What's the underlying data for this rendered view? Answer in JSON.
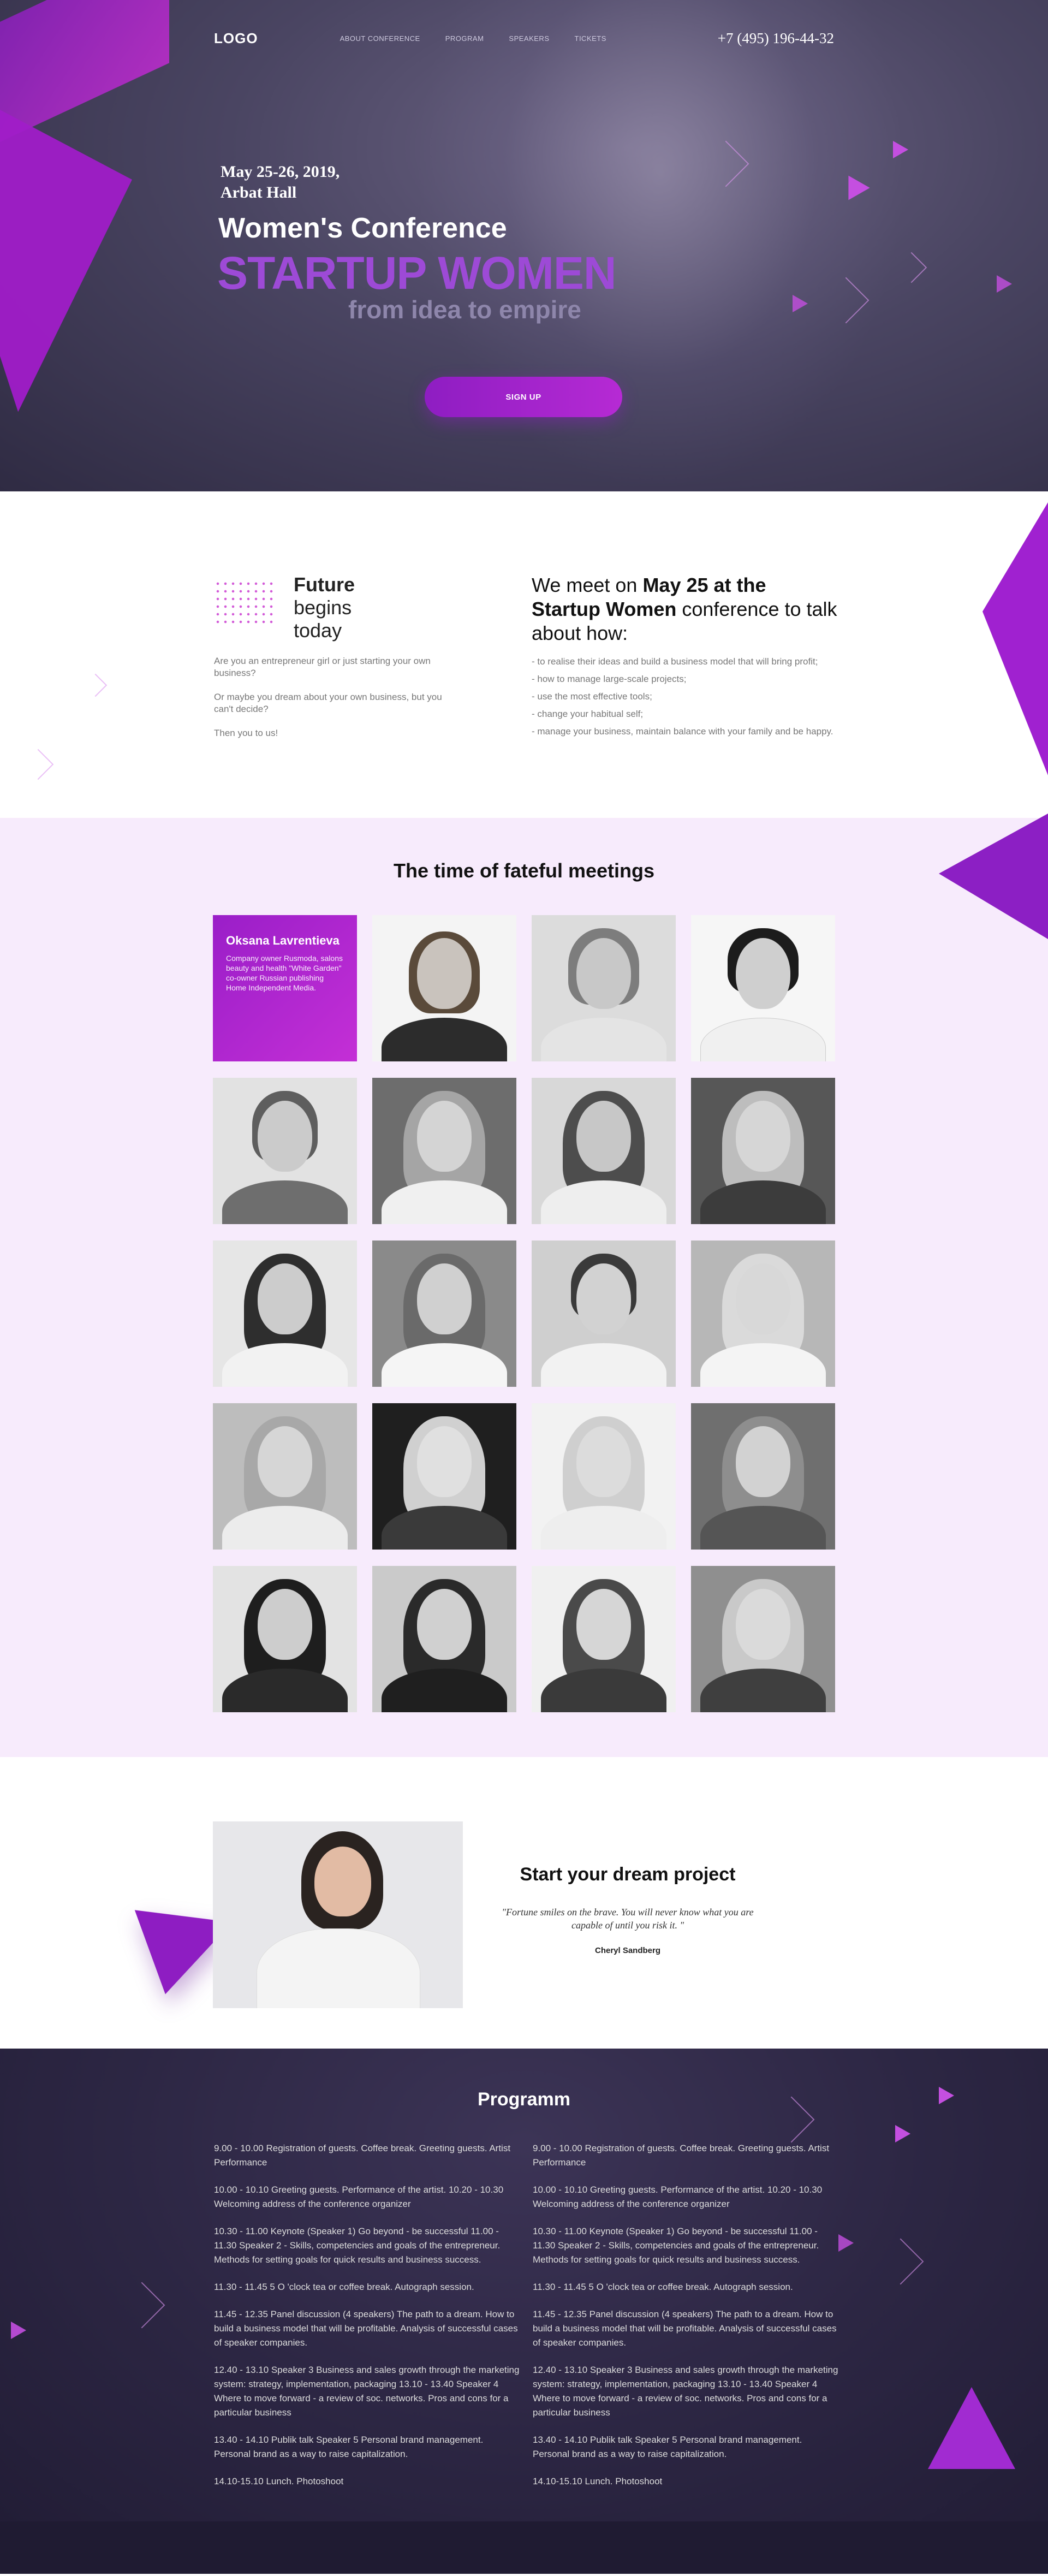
{
  "header": {
    "logo": "LOGO",
    "menu": [
      "ABOUT CONFERENCE",
      "PROGRAM",
      "SPEAKERS",
      "TICKETS"
    ],
    "phone": "+7 (495) 196-44-32"
  },
  "hero": {
    "date_line1": "May 25-26, 2019,",
    "date_line2": "Arbat Hall",
    "title1": "Women's Conference",
    "title2": "STARTUP WOMEN",
    "title3": "from idea to empire",
    "button": "SIGN UP"
  },
  "future": {
    "heading_bold": "Future",
    "heading_rest1": "begins",
    "heading_rest2": "today",
    "paragraphs": [
      "Are you an entrepreneur girl or just starting your own business?",
      "Or maybe you dream about your own business, but you can't decide?",
      "Then you to us!"
    ],
    "meet_prefix": "We meet on ",
    "meet_bold1": "May 25 at the Startup Women",
    "meet_suffix": " conference to talk about how:",
    "list": [
      "- to realise their ideas and build a business model that will bring profit;",
      "- how to manage large-scale projects;",
      "- use the most effective tools;",
      "- change your habitual self;",
      "- manage your business, maintain balance with your family and be happy."
    ]
  },
  "speakers": {
    "heading": "The time of fateful meetings",
    "featured": {
      "name": "Oksana Lavrentieva",
      "description": "Company owner Rusmoda, salons beauty and health \"White Garden\" co-owner Russian publishing Home Independent Media."
    }
  },
  "quote": {
    "heading": "Start your dream project",
    "text": "\"Fortune smiles on the brave. You will never know what you are capable of until you risk it. \"",
    "author": "Cheryl Sandberg"
  },
  "programm": {
    "heading": "Programm",
    "left": [
      "9.00 - 10.00 Registration of guests. Coffee break. Greeting guests. Artist Performance",
      "10.00 - 10.10 Greeting guests. Performance of the artist. 10.20 - 10.30 Welcoming address of the conference organizer",
      "10.30 - 11.00 Keynote (Speaker 1) Go beyond - be successful 11.00 - 11.30 Speaker 2 - Skills, competencies and goals of the entrepreneur. Methods for setting goals for quick results and business success.",
      "11.30 - 11.45 5 O 'clock tea or coffee break. Autograph session.",
      "11.45 - 12.35 Panel discussion (4 speakers) The path to a dream. How to build a business model that will be profitable. Analysis of successful cases of speaker companies.",
      "12.40 - 13.10 Speaker 3 Business and sales growth through the marketing system: strategy, implementation, packaging 13.10 - 13.40 Speaker 4 Where to move forward - a review of soc. networks. Pros and cons for a particular business",
      "13.40 - 14.10 Publik talk Speaker 5 Personal brand management. Personal brand as a way to raise capitalization.",
      "14.10-15.10 Lunch. Photoshoot"
    ],
    "right": [
      "9.00 - 10.00 Registration of guests. Coffee break. Greeting guests. Artist Performance",
      "10.00 - 10.10 Greeting guests. Performance of the artist. 10.20 - 10.30 Welcoming address of the conference organizer",
      "10.30 - 11.00 Keynote (Speaker 1) Go beyond - be successful 11.00 - 11.30 Speaker 2 - Skills, competencies and goals of the entrepreneur. Methods for setting goals for quick results and business success.",
      "11.30 - 11.45 5 O 'clock tea or coffee break. Autograph session.",
      "11.45 - 12.35 Panel discussion (4 speakers) The path to a dream. How to build a business model that will be profitable. Analysis of successful cases of speaker companies.",
      "12.40 - 13.10 Speaker 3 Business and sales growth through the marketing system: strategy, implementation, packaging 13.10 - 13.40 Speaker 4 Where to move forward - a review of soc. networks. Pros and cons for a particular business",
      "13.40 - 14.10 Publik talk Speaker 5 Personal brand management. Personal brand as a way to raise capitalization.",
      "14.10-15.10 Lunch. Photoshoot"
    ]
  },
  "colors": {
    "accent": "#9d1fcc",
    "hero_bg": "#4a4562",
    "speakers_bg": "#f7ebfc",
    "programm_bg": "#2c2643"
  }
}
